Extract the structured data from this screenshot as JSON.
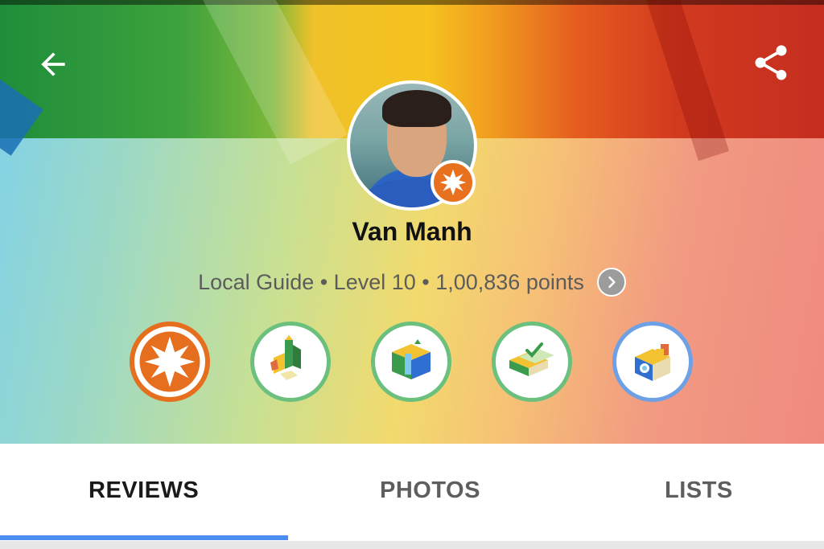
{
  "header": {
    "back_icon": "arrow-left-icon",
    "share_icon": "share-icon"
  },
  "profile": {
    "name": "Van Manh",
    "stats": "Local Guide • Level 10 • 1,00,836 points",
    "avatar_badge_icon": "starburst-icon",
    "stats_chevron_icon": "chevron-right-icon"
  },
  "badges": [
    {
      "icon": "starburst-icon",
      "ring_color": "#e56f1e"
    },
    {
      "icon": "reviewer-badge-icon",
      "ring_color": "#6cc07d"
    },
    {
      "icon": "fact-finder-badge-icon",
      "ring_color": "#6cc07d"
    },
    {
      "icon": "fact-checker-badge-icon",
      "ring_color": "#6cc07d"
    },
    {
      "icon": "photographer-badge-icon",
      "ring_color": "#6ea0e6"
    }
  ],
  "tabs": [
    {
      "label": "REVIEWS",
      "active": true
    },
    {
      "label": "PHOTOS",
      "active": false
    },
    {
      "label": "LISTS",
      "active": false
    }
  ],
  "colors": {
    "accent": "#4c8ef0",
    "level_orange": "#e56f1e",
    "badge_green": "#6cc07d",
    "badge_blue": "#6ea0e6"
  }
}
